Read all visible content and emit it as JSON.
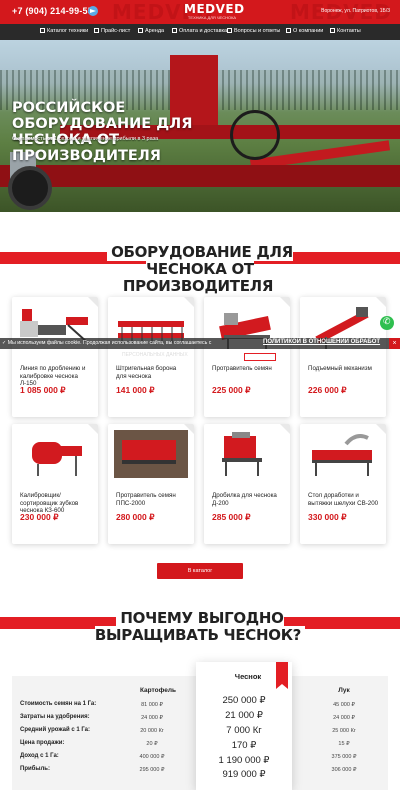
{
  "header": {
    "phone": "+7 (904) 214-99-55",
    "logo": "MEDVED",
    "logo_sub": "ТЕХНИКА ДЛЯ ЧЕСНОКА",
    "bg_word": "MEDVED",
    "address": "Воронеж, ул. Патриотов, 1Б/3",
    "nav": [
      "Каталог техники",
      "Прайс-лист",
      "Аренда",
      "Оплата и доставка",
      "Вопросы и ответы",
      "О компании",
      "Контакты"
    ]
  },
  "hero": {
    "title": "Российское оборудование для чеснока от производителя",
    "subtitle": "Окупаемость от 1 сезона и увеличение прибыли в 3 раза"
  },
  "products_section": {
    "title": "Оборудование для чеснока от производителя",
    "items": [
      {
        "name": "Линия по дроблению и калибровке чеснока Л-150",
        "price": "1 085 000 ₽"
      },
      {
        "name": "Штригельная борона для чеснока",
        "price": "141 000 ₽"
      },
      {
        "name": "Протравитель семян",
        "price": "225 000 ₽"
      },
      {
        "name": "Подъемный механизм",
        "price": "226 000 ₽"
      },
      {
        "name": "Калибровщик/ сортировщик зубков чеснока КЗ-600",
        "price": "230 000 ₽"
      },
      {
        "name": "Протравитель семян ППС-2000",
        "price": "280 000 ₽"
      },
      {
        "name": "Дробилка для чеснока Д-200",
        "price": "285 000 ₽"
      },
      {
        "name": "Стол доработки и вытяжки шелухи СВ-200",
        "price": "330 000 ₽"
      }
    ],
    "catalog_button": "В каталог"
  },
  "cookie": {
    "text": "Мы используем файлы cookie. Продолжая использование сайта, вы соглашаетесь с",
    "link": "ПОЛИТИКОЙ В ОТНОШЕНИИ ОБРАБОТ",
    "ghost_text": "ПЕРСОНАЛЬНЫХ ДАННЫХ",
    "close": "×"
  },
  "compare_section": {
    "title": "Почему выгодно выращивать чеснок?",
    "columns": [
      "Картофель",
      "Чеснок",
      "Лук"
    ],
    "rows": [
      {
        "label": "Стоимость семян на 1 Га:",
        "values": [
          "81 000 ₽",
          "250 000 ₽",
          "45 000 ₽"
        ]
      },
      {
        "label": "Затраты на удобрения:",
        "values": [
          "24 000 ₽",
          "21 000 ₽",
          "24 000 ₽"
        ]
      },
      {
        "label": "Средний урожай с 1 Га:",
        "values": [
          "20 000 Кг",
          "7 000 Кг",
          "25 000 Кг"
        ]
      },
      {
        "label": "Цена продажи:",
        "values": [
          "20 ₽",
          "170 ₽",
          "15 ₽"
        ]
      },
      {
        "label": "Доход с 1 Га:",
        "values": [
          "400 000 ₽",
          "1 190 000 ₽",
          "375 000 ₽"
        ]
      },
      {
        "label": "Прибыль:",
        "values": [
          "295 000 ₽",
          "919 000 ₽",
          "306 000 ₽"
        ]
      }
    ]
  },
  "colors": {
    "accent": "#d3181c",
    "dark": "#2a2a2a",
    "whatsapp": "#2fbf4f"
  }
}
